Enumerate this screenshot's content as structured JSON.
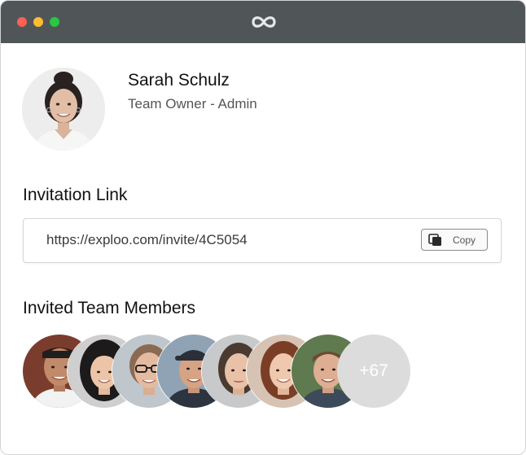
{
  "window": {
    "controls": [
      "close",
      "minimize",
      "maximize"
    ],
    "logo_icon": "infinity-icon"
  },
  "profile": {
    "name": "Sarah Schulz",
    "role": "Team Owner - Admin"
  },
  "invitation": {
    "title": "Invitation Link",
    "url": "https://exploo.com/invite/4C5054",
    "copy_label": "Copy",
    "copy_icon": "copy-icon"
  },
  "members": {
    "title": "Invited Team Members",
    "more_count": "+67"
  },
  "colors": {
    "titlebar": "#505558",
    "close": "#fe5f57",
    "minimize": "#febc2e",
    "maximize": "#28c840",
    "more_badge": "#dcdcdc"
  }
}
